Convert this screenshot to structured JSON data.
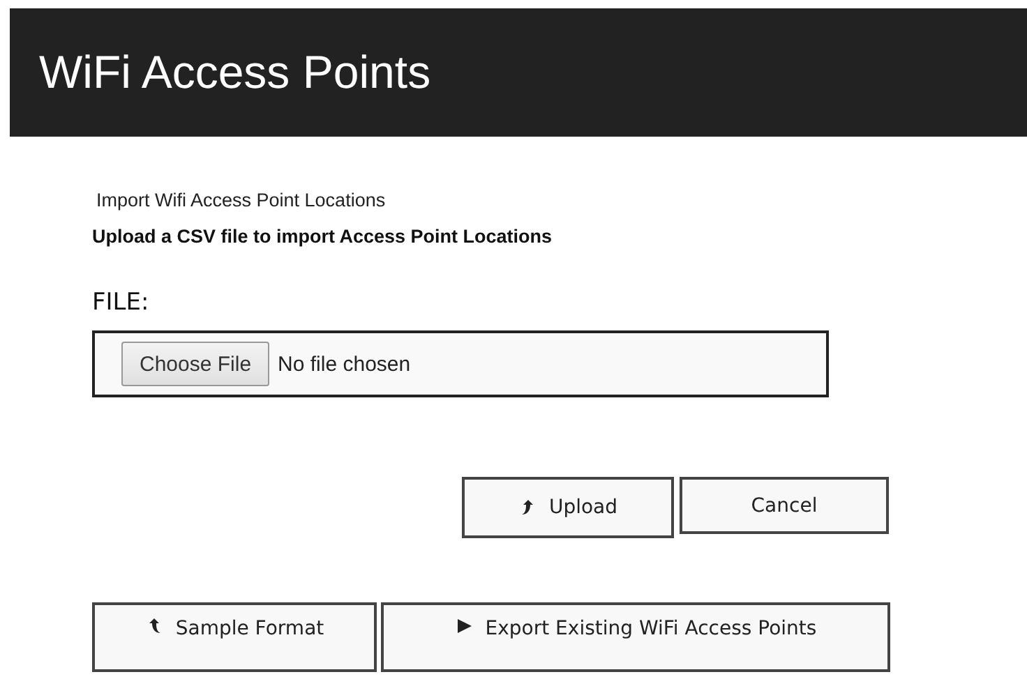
{
  "header": {
    "title": "WiFi Access Points"
  },
  "intro": {
    "heading": "Import Wifi Access Point Locations",
    "instruction": "Upload a CSV file to import Access Point Locations"
  },
  "file_field": {
    "label": "FILE:",
    "button": "Choose File",
    "value": "No file chosen"
  },
  "form_buttons": [
    {
      "label": "Upload",
      "kind": "upload"
    },
    {
      "label": "Cancel",
      "kind": "plain"
    }
  ],
  "bottom_buttons": [
    {
      "label": "Sample Format",
      "kind": "back"
    },
    {
      "label": "Export Existing WiFi Access Points",
      "kind": "play"
    }
  ]
}
